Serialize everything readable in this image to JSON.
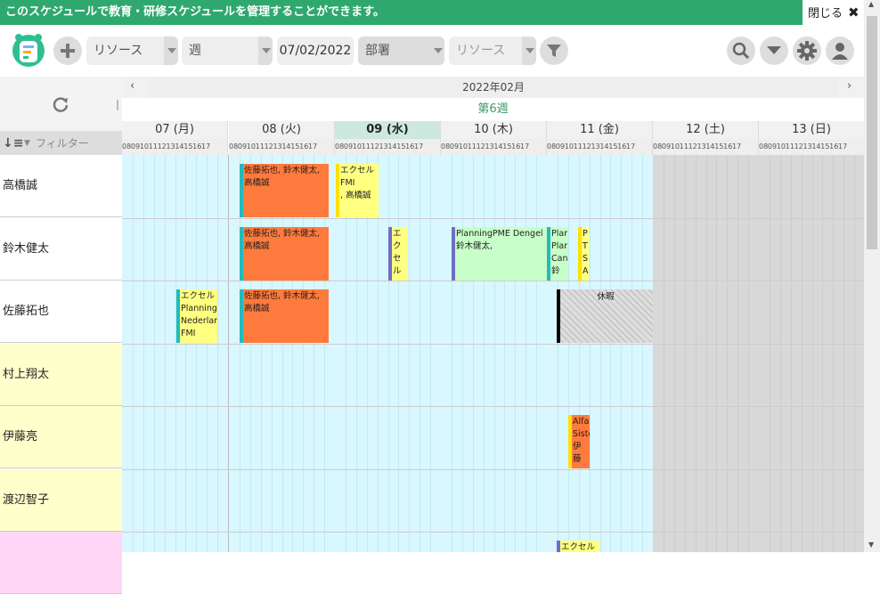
{
  "banner": {
    "message": "このスケジュールで教育・研修スケジュールを管理することができます。",
    "close_label": "閉じる"
  },
  "toolbar": {
    "resource_select": "リソース",
    "view_select": "週",
    "date": "07/02/2022",
    "department_select": "部署",
    "resource_filter": "リソース"
  },
  "left": {
    "filter_placeholder": "フィルター",
    "resources": [
      "高橋誠",
      "鈴木健太",
      "佐藤拓也",
      "村上翔太",
      "伊藤亮",
      "渡辺智子",
      ""
    ]
  },
  "calendar": {
    "month_title": "2022年02月",
    "week_label": "第6週",
    "days": [
      "07 (月)",
      "08 (火)",
      "09 (水)",
      "10 (木)",
      "11 (金)",
      "12 (土)",
      "13 (日)"
    ],
    "hours": [
      "08",
      "09",
      "10",
      "11",
      "12",
      "13",
      "14",
      "15",
      "16",
      "17"
    ],
    "today_index": 2
  },
  "events": [
    {
      "row": 0,
      "text": "佐藤拓也, 鈴木健太,\n高橋誠",
      "color": "#ff7a3d",
      "bar": "#2bb"
    },
    {
      "row": 0,
      "text": "エクセル\nFMI\n, 高橋誠",
      "color": "#ffff80",
      "bar": "#ffe000"
    },
    {
      "row": 1,
      "text": "佐藤拓也, 鈴木健太,\n高橋誠",
      "color": "#ff7a3d",
      "bar": "#2bb"
    },
    {
      "row": 1,
      "text": "エ\nク\nセ\nル",
      "color": "#ffff80",
      "bar": "#6e6ec8"
    },
    {
      "row": 1,
      "text": "PlanningPME Dengel\n鈴木健太,",
      "color": "#c8ffc8",
      "bar": "#6e6ec8"
    },
    {
      "row": 1,
      "text": "Plar\nPlar\nCan\n鈴",
      "color": "#c8ffc8",
      "bar": "#2bb"
    },
    {
      "row": 1,
      "text": "P\nT\nS\nA",
      "color": "#ffff80",
      "bar": "#ffe000"
    },
    {
      "row": 2,
      "text": "エクセル\nPlanningF\nNederlan\nFMI",
      "color": "#ffff80",
      "bar": "#2bb"
    },
    {
      "row": 2,
      "text": "佐藤拓也, 鈴木健太,\n高橋誠",
      "color": "#ff7a3d",
      "bar": "#2bb"
    },
    {
      "row": 2,
      "text": "休暇",
      "color": "hatch",
      "bar": "#000"
    },
    {
      "row": 4,
      "text": "Alfa\nSiste\n伊\n藤",
      "color": "#ff7a3d",
      "bar": "#ffe000"
    },
    {
      "row": 6,
      "text": "エクセル",
      "color": "#ffff80",
      "bar": "#6e6ec8"
    }
  ]
}
